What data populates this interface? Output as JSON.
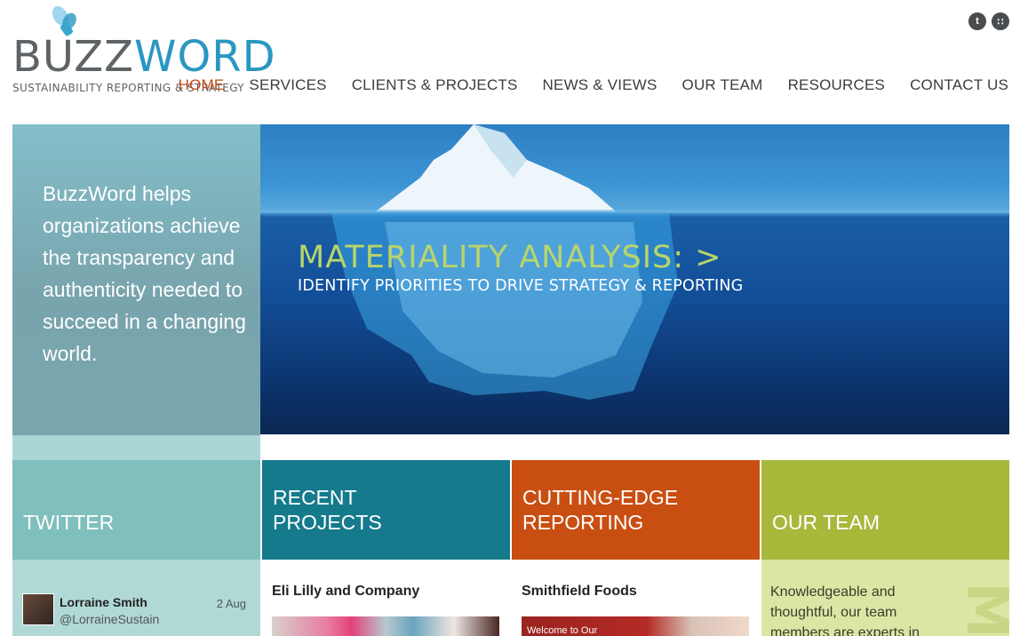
{
  "brand": {
    "buzz": "BUZZ",
    "word": "WORD",
    "tagline": "SUSTAINABILITY REPORTING & STRATEGY"
  },
  "social": [
    {
      "icon": "twitter-icon",
      "glyph": "t"
    },
    {
      "icon": "rss-icon",
      "glyph": "∷"
    }
  ],
  "nav": [
    {
      "label": "HOME",
      "active": true
    },
    {
      "label": "SERVICES",
      "active": false
    },
    {
      "label": "CLIENTS & PROJECTS",
      "active": false
    },
    {
      "label": "NEWS & VIEWS",
      "active": false
    },
    {
      "label": "OUR TEAM",
      "active": false
    },
    {
      "label": "RESOURCES",
      "active": false
    },
    {
      "label": "CONTACT US",
      "active": false
    }
  ],
  "hero": {
    "intro": "BuzzWord helps organizations achieve the transparency and authenticity needed to succeed in a changing world.",
    "slide_title": "MATERIALITY ANALYSIS: >",
    "slide_subtitle": "IDENTIFY PRIORITIES TO DRIVE STRATEGY & REPORTING"
  },
  "tiles": {
    "twitter": "TWITTER",
    "recent_projects": "RECENT PROJECTS",
    "cutting_edge": "CUTTING-EDGE REPORTING",
    "our_team": "OUR TEAM"
  },
  "tweet": {
    "name": "Lorraine Smith",
    "handle": "@LorraineSustain",
    "date": "2 Aug"
  },
  "projects": {
    "recent": "Eli Lilly and Company",
    "reporting": "Smithfield Foods",
    "reporting_image_text": "Welcome to Our"
  },
  "team": {
    "blurb": "Knowledgeable and thoughtful, our team members are experts in",
    "watermark": "M"
  },
  "colors": {
    "accent_active": "#c24a14",
    "twitter_tile": "#7fbfbd",
    "projects_tile": "#157a8c",
    "reporting_tile": "#c94e12",
    "team_tile": "#a8b83b"
  }
}
